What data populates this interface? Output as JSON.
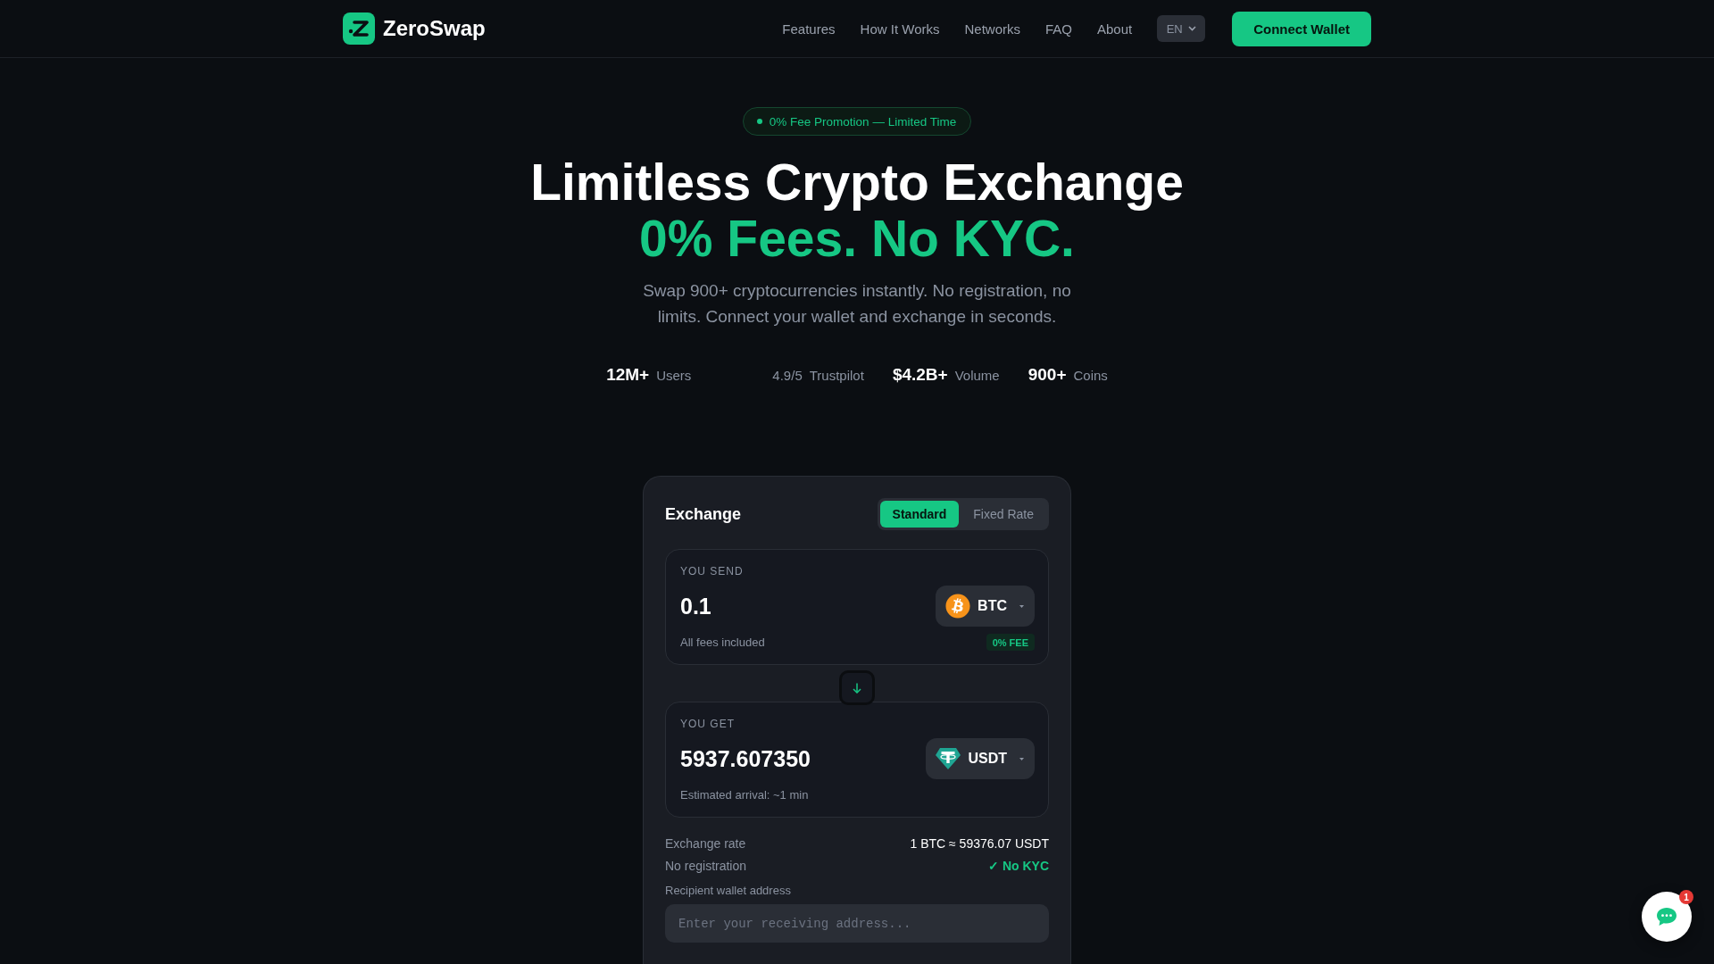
{
  "header": {
    "brand": "ZeroSwap",
    "nav": [
      "Features",
      "How It Works",
      "Networks",
      "FAQ",
      "About"
    ],
    "language": "EN",
    "cta": "Connect Wallet"
  },
  "hero": {
    "badge": "0% Fee Promotion — Limited Time",
    "title": "Limitless Crypto Exchange",
    "highlight": "0% Fees. No KYC.",
    "subtitle": "Swap 900+ cryptocurrencies instantly. No registration, no limits. Connect your wallet and exchange in seconds.",
    "stats": [
      {
        "kind": "figure",
        "value": "12M+",
        "label": "Users"
      },
      {
        "kind": "rating",
        "value": "4.9/5",
        "label": "Trustpilot"
      },
      {
        "kind": "figure",
        "value": "$4.2B+",
        "label": "Volume"
      },
      {
        "kind": "figure",
        "value": "900+",
        "label": "Coins"
      }
    ]
  },
  "exchange": {
    "title": "Exchange",
    "modes": [
      {
        "label": "Standard",
        "selected": true
      },
      {
        "label": "Fixed Rate",
        "selected": false
      }
    ],
    "send": {
      "label": "YOU SEND",
      "amount": "0.1",
      "token": "BTC",
      "note": "All fees included",
      "badge": "0% FEE"
    },
    "receive": {
      "label": "YOU GET",
      "amount": "5937.607350",
      "token": "USDT",
      "note": "Estimated arrival: ~1 min"
    },
    "details": [
      {
        "kind": "plain",
        "label": "Exchange rate",
        "value": "1 BTC ≈ 59376.07 USDT"
      },
      {
        "kind": "positive",
        "label": "No registration",
        "value": "✓ No KYC"
      }
    ],
    "address": {
      "label": "Recipient wallet address",
      "placeholder": "Enter your receiving address..."
    }
  },
  "chat": {
    "unread": "1"
  }
}
